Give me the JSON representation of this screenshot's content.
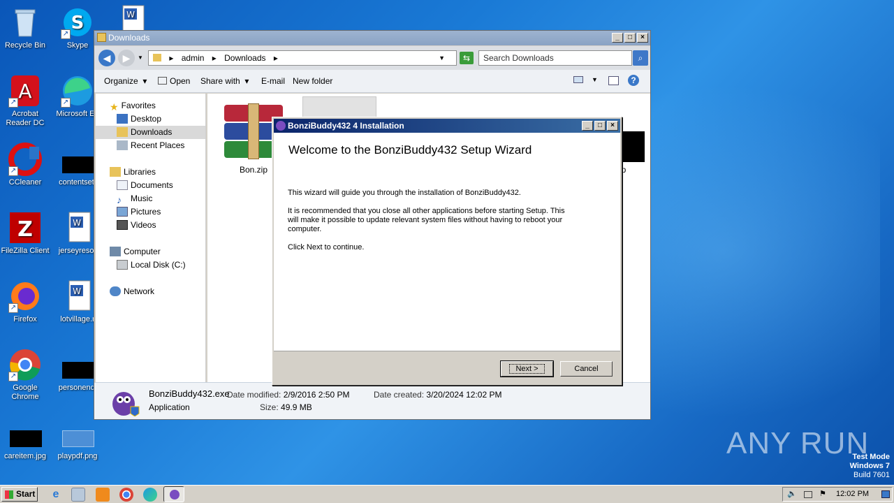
{
  "desktop": {
    "icons": [
      {
        "label": "Recycle Bin"
      },
      {
        "label": "Skype"
      },
      {
        "label": "Acrobat Reader DC"
      },
      {
        "label": "Microsoft Ed"
      },
      {
        "label": "CCleaner"
      },
      {
        "label": "contentsett"
      },
      {
        "label": "FileZilla Client"
      },
      {
        "label": "jerseyresor"
      },
      {
        "label": "Firefox"
      },
      {
        "label": "lotvillage.r"
      },
      {
        "label": "Google Chrome"
      },
      {
        "label": "personendi"
      },
      {
        "label": "careitem.jpg"
      },
      {
        "label": "playpdf.png"
      }
    ]
  },
  "explorer": {
    "title": "Downloads",
    "breadcrumb": [
      "admin",
      "Downloads"
    ],
    "search_placeholder": "Search Downloads",
    "toolbar": {
      "organize": "Organize",
      "open": "Open",
      "share_with": "Share with",
      "email": "E-mail",
      "new_folder": "New folder"
    },
    "nav": {
      "favorites": "Favorites",
      "desktop": "Desktop",
      "downloads": "Downloads",
      "recent_places": "Recent Places",
      "libraries": "Libraries",
      "documents": "Documents",
      "music": "Music",
      "pictures": "Pictures",
      "videos": "Videos",
      "computer": "Computer",
      "local_disk": "Local Disk (C:)",
      "network": "Network"
    },
    "files": [
      {
        "name": "Bon.zip"
      },
      {
        "name": "jp"
      }
    ],
    "details": {
      "filename": "BonziBuddy432.exe",
      "type": "Application",
      "date_modified_label": "Date modified:",
      "date_modified": "2/9/2016 2:50 PM",
      "date_created_label": "Date created:",
      "date_created": "3/20/2024 12:02 PM",
      "size_label": "Size:",
      "size": "49.9 MB"
    }
  },
  "installer": {
    "title": "BonziBuddy432 4 Installation",
    "heading": "Welcome to the BonziBuddy432 Setup Wizard",
    "para1": "This wizard will guide you through the installation of BonziBuddy432.",
    "para2": "It is recommended that you close all other applications before starting Setup. This will make it possible to update relevant system files without having to reboot your computer.",
    "para3": "Click Next to continue.",
    "next_label": "Next >",
    "cancel_label": "Cancel"
  },
  "taskbar": {
    "start_label": "Start",
    "clock": "12:02 PM"
  },
  "watermark": {
    "brand": "ANY RUN",
    "line1": "Test Mode",
    "line2": "Windows 7",
    "line3": "Build 7601"
  }
}
